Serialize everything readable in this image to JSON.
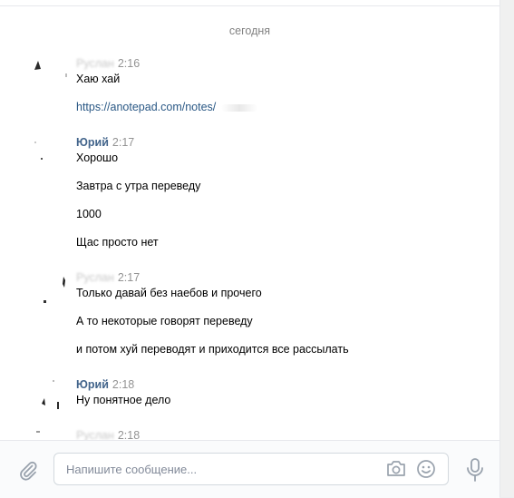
{
  "chat": {
    "date_separator": "сегодня",
    "messages": [
      {
        "author": "",
        "time": "2:16",
        "lines": [
          "Хаю хай",
          "https://anotepad.com/notes/"
        ]
      },
      {
        "author": "Юрий",
        "time": "2:17",
        "lines": [
          "Хорошо",
          "Завтра с утра переведу",
          "1000",
          "Щас просто нет"
        ]
      },
      {
        "author": "",
        "time": "2:17",
        "lines": [
          "Только давай без наебов и прочего",
          "А то некоторые говорят переведу",
          "и потом хуй переводят и приходится все рассылать"
        ]
      },
      {
        "author": "Юрий",
        "time": "2:18",
        "lines": [
          "Ну понятное дело"
        ]
      },
      {
        "author": "",
        "time": "2:18",
        "lines": []
      }
    ]
  },
  "composer": {
    "placeholder": "Напишите сообщение...",
    "icons": {
      "attach": "paperclip-icon",
      "camera": "camera-icon",
      "emoji": "smiley-icon",
      "voice": "microphone-icon"
    }
  },
  "colors": {
    "author_link": "#42648b",
    "link": "#2a5885",
    "time": "#939393",
    "icon": "#99a2ad"
  }
}
